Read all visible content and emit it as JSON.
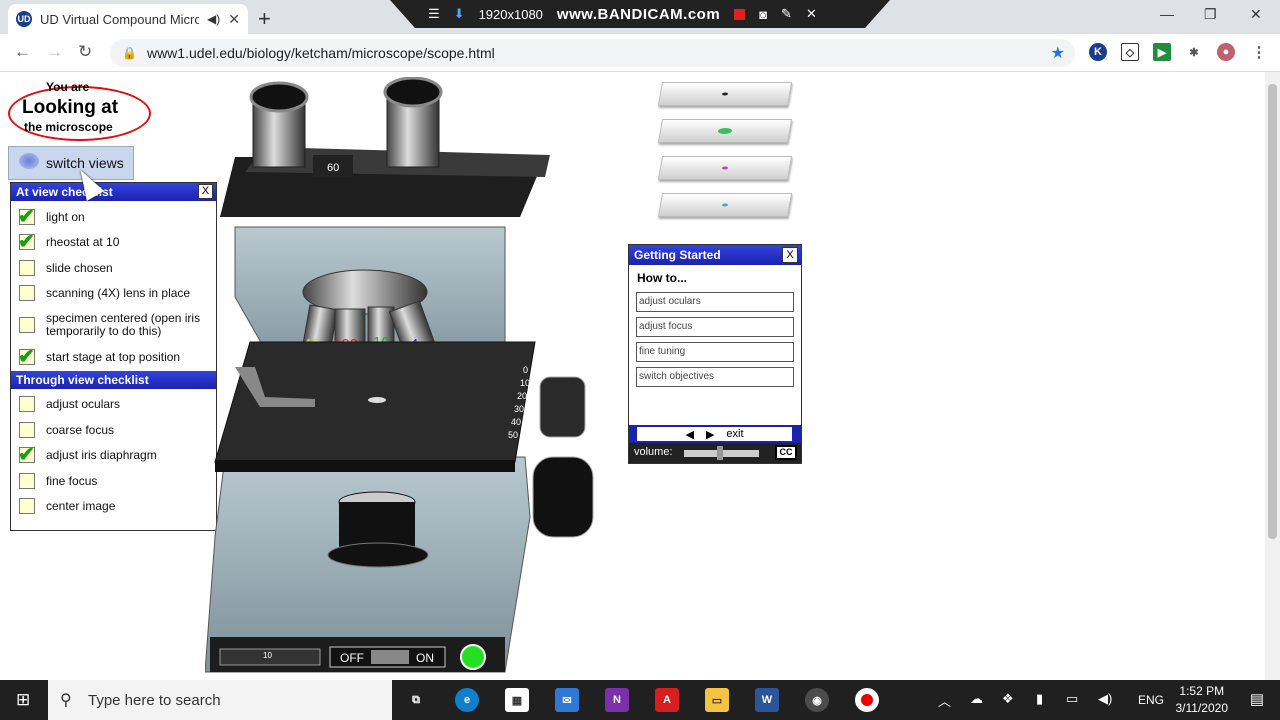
{
  "browser": {
    "tab_title": "UD Virtual Compound Micro",
    "new_tab": "+",
    "url": "www1.udel.edu/biology/ketcham/microscope/scope.html",
    "recorder": {
      "resolution": "1920x1080",
      "brand": "www.BANDICAM.com"
    },
    "window_controls": {
      "minimize": "—",
      "restore": "❐",
      "close": "✕"
    }
  },
  "view": {
    "small": "You are",
    "big": "Looking at",
    "sub": "the microscope"
  },
  "switch_views": "switch views",
  "at_view": {
    "title": "At view checklist",
    "close": "X",
    "items": [
      {
        "label": "light on",
        "checked": true
      },
      {
        "label": "rheostat at 10",
        "checked": true
      },
      {
        "label": "slide chosen",
        "checked": false
      },
      {
        "label": "scanning (4X) lens in place",
        "checked": false
      },
      {
        "label": "specimen centered (open iris temporarily to do this)",
        "checked": false
      },
      {
        "label": "start stage at top position",
        "checked": true
      }
    ]
  },
  "through_view": {
    "title": "Through view checklist",
    "items": [
      {
        "label": "adjust oculars",
        "checked": false
      },
      {
        "label": "coarse focus",
        "checked": false
      },
      {
        "label": "adjust iris diaphragm",
        "checked": true
      },
      {
        "label": "fine focus",
        "checked": false
      },
      {
        "label": "center image",
        "checked": false
      }
    ]
  },
  "microscope": {
    "ocular_scale": "60",
    "objectives": [
      "40",
      "100",
      "10",
      "4"
    ],
    "stage_scale": [
      "0",
      "10",
      "20",
      "30",
      "40",
      "50"
    ],
    "rheostat_value": "10",
    "power_off": "OFF",
    "power_on": "ON",
    "power_state": "on"
  },
  "slides": [
    {
      "spot_color": "#222222"
    },
    {
      "spot_color": "#3cbf5a"
    },
    {
      "spot_color": "#c040c0"
    },
    {
      "spot_color": "#40a8d8"
    }
  ],
  "getting_started": {
    "title": "Getting Started",
    "close": "X",
    "how_to": "How to...",
    "links": [
      "adjust oculars",
      "adjust focus",
      "fine tuning",
      "switch objectives"
    ],
    "exit": "exit",
    "volume_label": "volume:",
    "cc": "CC"
  },
  "taskbar": {
    "search_placeholder": "Type here to search",
    "lang": "ENG",
    "time": "1:52 PM",
    "date": "3/11/2020"
  }
}
